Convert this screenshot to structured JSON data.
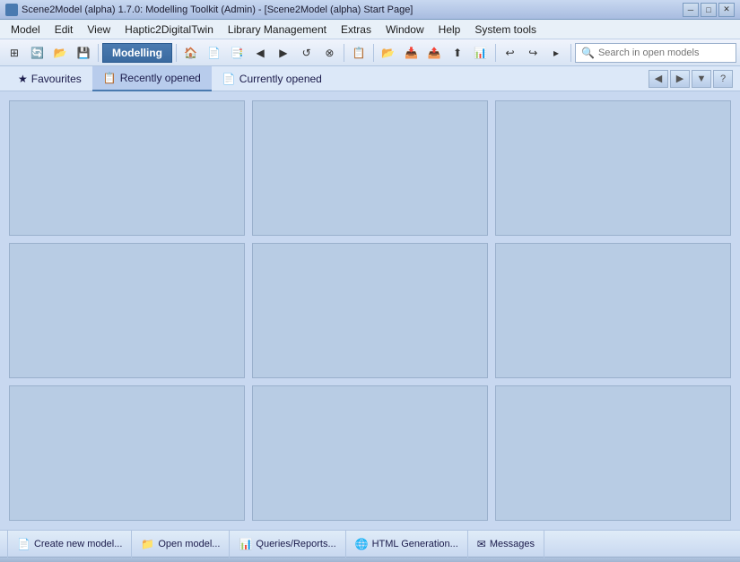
{
  "titlebar": {
    "title": "Scene2Model (alpha) 1.7.0: Modelling Toolkit (Admin) - [Scene2Model (alpha) Start Page]",
    "min_btn": "─",
    "max_btn": "□",
    "close_btn": "✕"
  },
  "menubar": {
    "items": [
      {
        "label": "Model",
        "id": "model"
      },
      {
        "label": "Edit",
        "id": "edit"
      },
      {
        "label": "View",
        "id": "view"
      },
      {
        "label": "Haptic2DigitalTwin",
        "id": "haptic"
      },
      {
        "label": "Library Management",
        "id": "library"
      },
      {
        "label": "Extras",
        "id": "extras"
      },
      {
        "label": "Window",
        "id": "window"
      },
      {
        "label": "Help",
        "id": "help"
      },
      {
        "label": "System tools",
        "id": "system"
      }
    ]
  },
  "toolbar": {
    "modelling_label": "Modelling",
    "search_placeholder": "Search in open models",
    "buttons": [
      {
        "icon": "⚙",
        "name": "settings-icon"
      },
      {
        "icon": "🔄",
        "name": "refresh-icon"
      },
      {
        "icon": "📋",
        "name": "copy-icon"
      },
      {
        "icon": "🔍",
        "name": "search-icon"
      }
    ]
  },
  "tabs": {
    "items": [
      {
        "label": "Favourites",
        "id": "favourites",
        "icon": "★"
      },
      {
        "label": "Recently opened",
        "id": "recently",
        "icon": "📋"
      },
      {
        "label": "Currently opened",
        "id": "currently",
        "icon": "📄"
      }
    ],
    "active": "recently"
  },
  "tiles": [
    {
      "id": 1
    },
    {
      "id": 2
    },
    {
      "id": 3
    },
    {
      "id": 4
    },
    {
      "id": 5
    },
    {
      "id": 6
    },
    {
      "id": 7
    },
    {
      "id": 8
    },
    {
      "id": 9
    }
  ],
  "statusbar": {
    "items": [
      {
        "label": "Create new model...",
        "icon": "📄",
        "id": "create"
      },
      {
        "label": "Open model...",
        "icon": "📁",
        "id": "open"
      },
      {
        "label": "Queries/Reports...",
        "icon": "📊",
        "id": "queries"
      },
      {
        "label": "HTML Generation...",
        "icon": "🌐",
        "id": "html"
      },
      {
        "label": "Messages",
        "icon": "✉",
        "id": "messages"
      }
    ]
  }
}
